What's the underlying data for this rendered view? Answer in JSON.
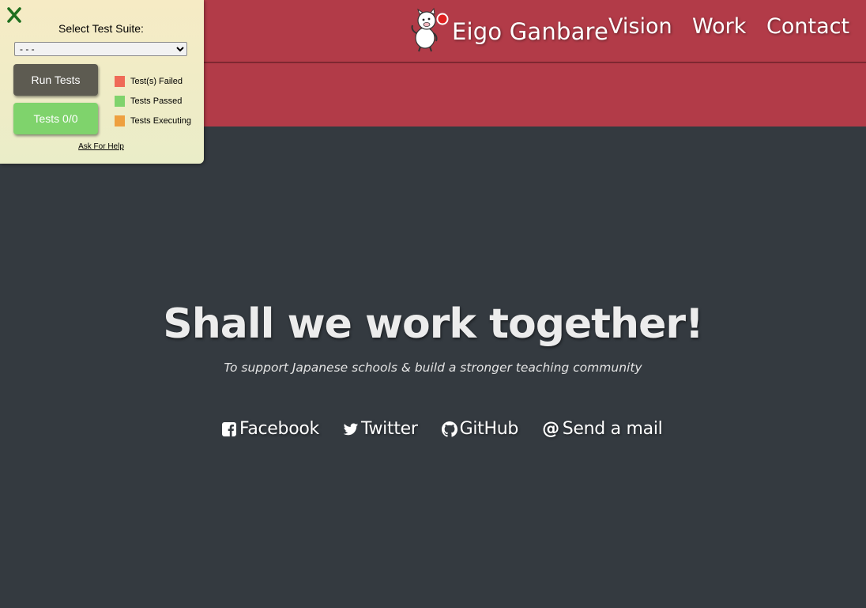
{
  "navbar": {
    "brand": "Eigo Ganbare",
    "links": [
      {
        "label": "Vision"
      },
      {
        "label": "Work"
      },
      {
        "label": "Contact"
      }
    ],
    "color": "#b23b48"
  },
  "test_panel": {
    "suite_label": "Select Test Suite:",
    "suite_selected": "- - -",
    "run_button": "Run Tests",
    "tests_button": "Tests 0/0",
    "legend": [
      {
        "label": "Test(s) Failed",
        "color": "#ef6a57"
      },
      {
        "label": "Tests Passed",
        "color": "#7fd36c"
      },
      {
        "label": "Tests Executing",
        "color": "#eea03f"
      }
    ],
    "help_link": "Ask For Help"
  },
  "hero": {
    "title": "Shall we work together!",
    "subtitle": "To support Japanese schools & build a stronger teaching community"
  },
  "social": [
    {
      "label": "Facebook",
      "icon": "facebook-icon"
    },
    {
      "label": "Twitter",
      "icon": "twitter-icon"
    },
    {
      "label": "GitHub",
      "icon": "github-icon"
    },
    {
      "label": "Send a mail",
      "icon": "at-icon"
    }
  ],
  "colors": {
    "background": "#343a40",
    "panel": "#f6ebc5"
  }
}
